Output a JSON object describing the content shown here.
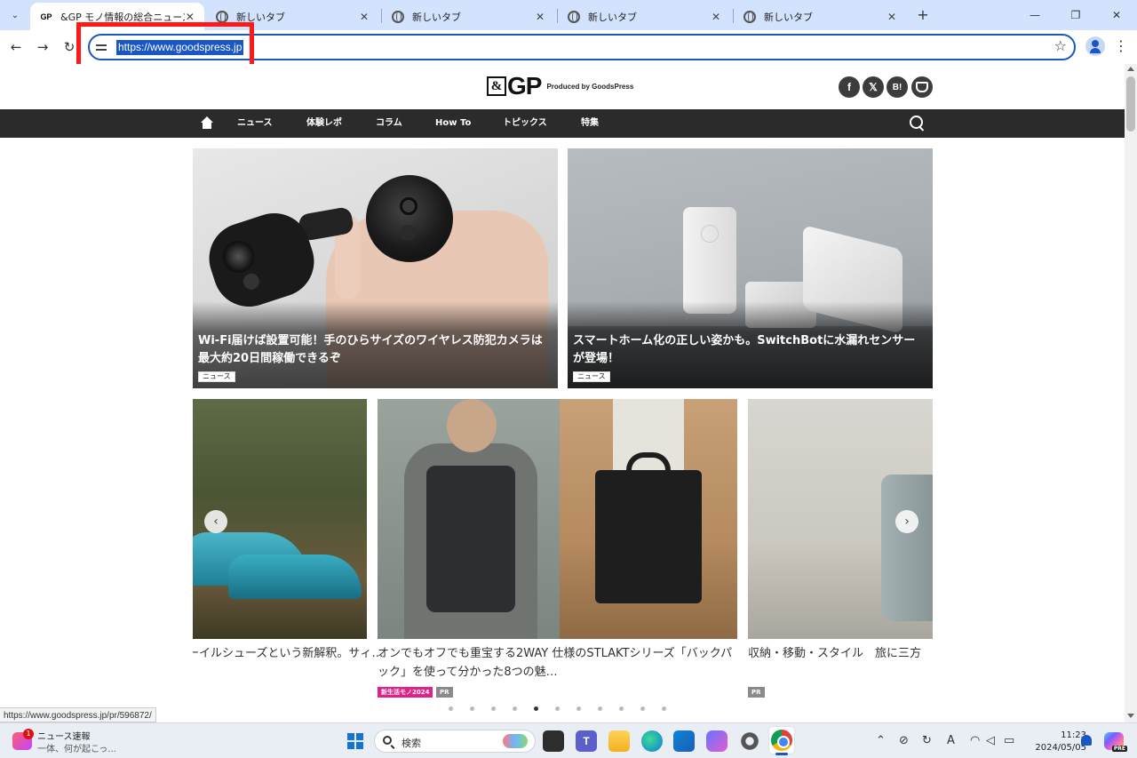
{
  "browser": {
    "tabs": [
      {
        "favicon": "gp-logo-icon",
        "title": "&GP モノ情報の総合ニュースサイト",
        "active": true
      },
      {
        "favicon": "globe-icon",
        "title": "新しいタブ",
        "active": false
      },
      {
        "favicon": "globe-icon",
        "title": "新しいタブ",
        "active": false
      },
      {
        "favicon": "globe-icon",
        "title": "新しいタブ",
        "active": false
      },
      {
        "favicon": "globe-icon",
        "title": "新しいタブ",
        "active": false
      }
    ],
    "tab_favicon_text": "GP",
    "close_glyph": "✕",
    "new_tab_glyph": "+",
    "address_url": "https://www.goodspress.jp",
    "status_url": "https://www.goodspress.jp/pr/596872/"
  },
  "site": {
    "logo": {
      "amp": "&",
      "gp": "GP",
      "tagline": "Produced by GoodsPress"
    },
    "social": [
      {
        "icon": "facebook-icon",
        "glyph": "f"
      },
      {
        "icon": "x-icon",
        "glyph": "𝕏"
      },
      {
        "icon": "hatena-bookmark-icon",
        "glyph": "B!"
      },
      {
        "icon": "pocket-icon",
        "glyph": ""
      }
    ],
    "nav": [
      "ニュース",
      "体験レポ",
      "コラム",
      "How To",
      "トピックス",
      "特集"
    ]
  },
  "features": [
    {
      "title": "Wi-Fi届けば設置可能！手のひらサイズのワイヤレス防犯カメラは最大約20日間稼働できるぞ",
      "tag": "ニュース"
    },
    {
      "title": "スマートホーム化の正しい姿かも。SwitchBotに水漏れセンサーが登場！",
      "tag": "ニュース"
    }
  ],
  "carousel": {
    "slides": [
      {
        "text": "ーイルシューズという新解釈。サィ…"
      },
      {
        "text": "オンでもオフでも重宝する2WAY 仕様のSTLAKTシリーズ「バックパック」を使って分かった8つの魅…",
        "badges": [
          "新生活モノ2024",
          "PR"
        ]
      },
      {
        "text": "収納・移動・スタイル　旅に三方",
        "badges": [
          "PR"
        ]
      }
    ],
    "prev_glyph": "‹",
    "next_glyph": "›",
    "dot_count": 11,
    "active_dot": 4
  },
  "taskbar": {
    "news_badge": "1",
    "news_title": "ニュース速報",
    "news_sub": "一体、何が起こっ...",
    "search_placeholder": "検索",
    "teams_label": "T",
    "time": "11:23",
    "date": "2024/05/05",
    "copilot_label": "PRE",
    "tray_ime": "A"
  }
}
